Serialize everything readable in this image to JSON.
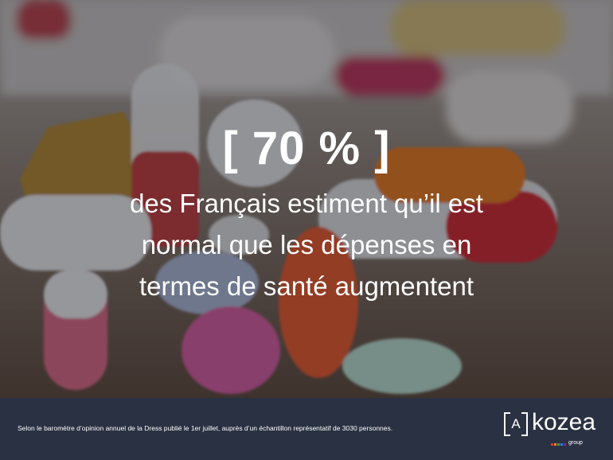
{
  "headline": {
    "stat": "[ 70 % ]",
    "caption_lines": [
      "des Français estiment qu’il est",
      "normal que les dépenses en",
      "termes de santé augmentent"
    ]
  },
  "footer": {
    "source": "Selon le baromètre d’opinion annuel de la Dress publié le 1er juillet, auprès d’un échantillon représentatif de 3030 personnes."
  },
  "logo": {
    "mark": "A",
    "word": "kozea",
    "sub": "group",
    "dot_colors": [
      "#e53935",
      "#fb8c00",
      "#43a047",
      "#1e88e5",
      "#8e24aa"
    ]
  },
  "colors": {
    "footer_background": "#2a3142",
    "text": "#ffffff"
  }
}
